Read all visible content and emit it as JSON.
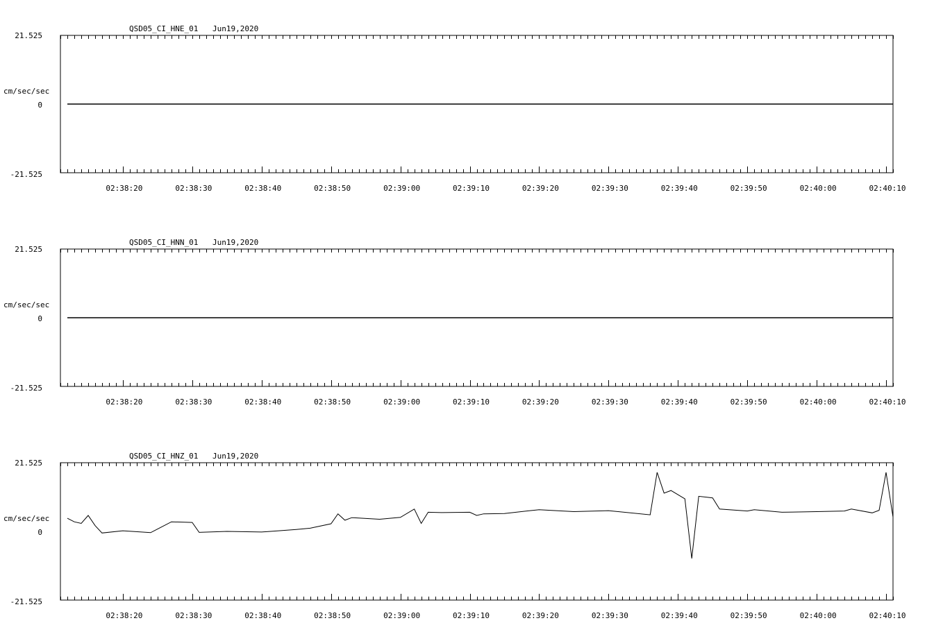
{
  "chart_data": [
    {
      "type": "line",
      "title": "QSD05_CI_HNE_01",
      "date": "Jun19,2020",
      "ylabel": "cm/sec/sec",
      "yticks": [
        "21.525",
        "0",
        "-21.525"
      ],
      "ylim": [
        -21.525,
        21.525
      ],
      "xlim": [
        "02:38:11",
        "02:40:11"
      ],
      "xticks": [
        "02:38:20",
        "02:38:30",
        "02:38:40",
        "02:38:50",
        "02:39:00",
        "02:39:10",
        "02:39:20",
        "02:39:30",
        "02:39:40",
        "02:39:50",
        "02:40:00",
        "02:40:10"
      ],
      "series": [
        {
          "x": [
            "02:38:12",
            "02:40:11"
          ],
          "values": [
            0,
            0
          ]
        }
      ]
    },
    {
      "type": "line",
      "title": "QSD05_CI_HNN_01",
      "date": "Jun19,2020",
      "ylabel": "cm/sec/sec",
      "yticks": [
        "21.525",
        "0",
        "-21.525"
      ],
      "ylim": [
        -21.525,
        21.525
      ],
      "xlim": [
        "02:38:11",
        "02:40:11"
      ],
      "xticks": [
        "02:38:20",
        "02:38:30",
        "02:38:40",
        "02:38:50",
        "02:39:00",
        "02:39:10",
        "02:39:20",
        "02:39:30",
        "02:39:40",
        "02:39:50",
        "02:40:00",
        "02:40:10"
      ],
      "series": [
        {
          "x": [
            "02:38:12",
            "02:40:11"
          ],
          "values": [
            0,
            0
          ]
        }
      ]
    },
    {
      "type": "line",
      "title": "QSD05_CI_HNZ_01",
      "date": "Jun19,2020",
      "ylabel": "cm/sec/sec",
      "yticks": [
        "21.525",
        "0",
        "-21.525"
      ],
      "ylim": [
        -21.525,
        21.525
      ],
      "xlim": [
        "02:38:11",
        "02:40:11"
      ],
      "xticks": [
        "02:38:20",
        "02:38:30",
        "02:38:40",
        "02:38:50",
        "02:39:00",
        "02:39:10",
        "02:39:20",
        "02:39:30",
        "02:39:40",
        "02:39:50",
        "02:40:00",
        "02:40:10"
      ],
      "series": [
        {
          "x": [
            "02:38:12",
            "02:38:13",
            "02:38:14",
            "02:38:15",
            "02:38:16",
            "02:38:17",
            "02:38:20",
            "02:38:24",
            "02:38:27",
            "02:38:30",
            "02:38:31",
            "02:38:35",
            "02:38:40",
            "02:38:45",
            "02:38:47",
            "02:38:50",
            "02:38:51",
            "02:38:52",
            "02:38:53",
            "02:38:57",
            "02:39:00",
            "02:39:02",
            "02:39:03",
            "02:39:04",
            "02:39:06",
            "02:39:10",
            "02:39:11",
            "02:39:12",
            "02:39:15",
            "02:39:20",
            "02:39:25",
            "02:39:30",
            "02:39:36",
            "02:39:37",
            "02:39:38",
            "02:39:39",
            "02:39:41",
            "02:39:42",
            "02:39:43",
            "02:39:45",
            "02:39:46",
            "02:39:50",
            "02:39:51",
            "02:39:55",
            "02:40:00",
            "02:40:04",
            "02:40:05",
            "02:40:08",
            "02:40:09",
            "02:40:10",
            "02:40:11"
          ],
          "values": [
            4.1,
            3.0,
            2.5,
            5.0,
            1.8,
            -0.5,
            0.2,
            -0.4,
            3.0,
            2.8,
            -0.3,
            0.0,
            -0.2,
            0.6,
            1.0,
            2.4,
            5.5,
            3.5,
            4.3,
            3.8,
            4.4,
            7.0,
            2.5,
            6.0,
            5.9,
            6.0,
            5.0,
            5.5,
            5.6,
            6.8,
            6.2,
            6.5,
            5.2,
            18.5,
            12.0,
            12.8,
            10.2,
            -8.5,
            11.0,
            10.5,
            7.0,
            6.4,
            6.8,
            6.0,
            6.2,
            6.4,
            7.0,
            5.8,
            6.6,
            18.5,
            4.5
          ]
        }
      ]
    }
  ]
}
